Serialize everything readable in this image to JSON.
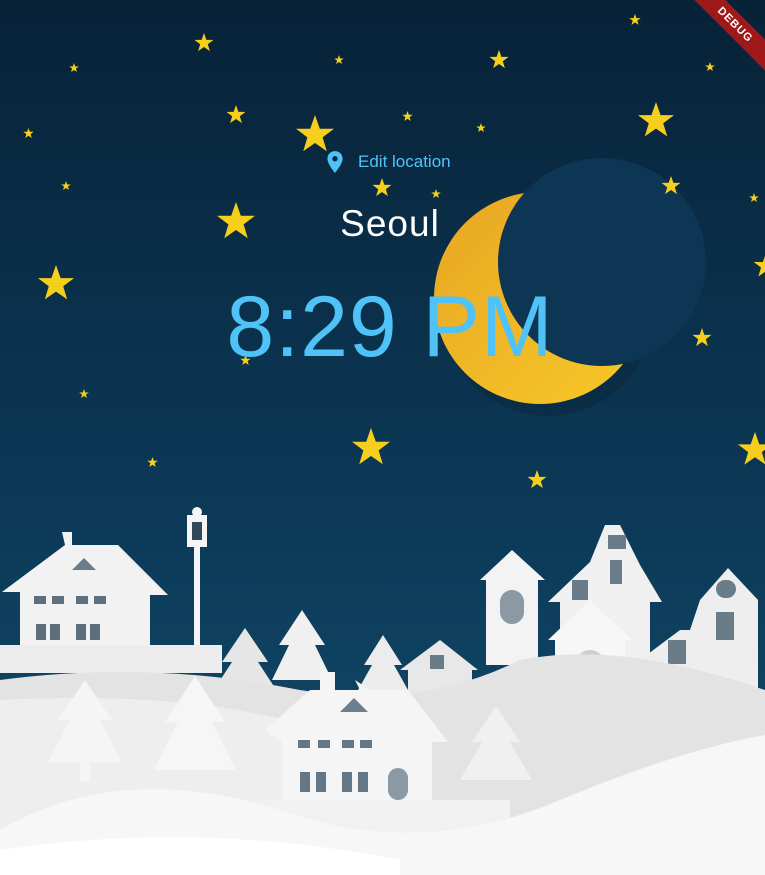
{
  "location": {
    "edit_label": "Edit location",
    "icon": "location-pin-icon"
  },
  "city": "Seoul",
  "time": "8:29 PM",
  "debug_banner": "DEBUG",
  "colors": {
    "sky_top": "#0a2a45",
    "sky_bottom": "#0f4666",
    "accent": "#4fc3f7",
    "moon": "#f2b824",
    "star": "#f7d21a",
    "snow": "#f4f4f4"
  }
}
